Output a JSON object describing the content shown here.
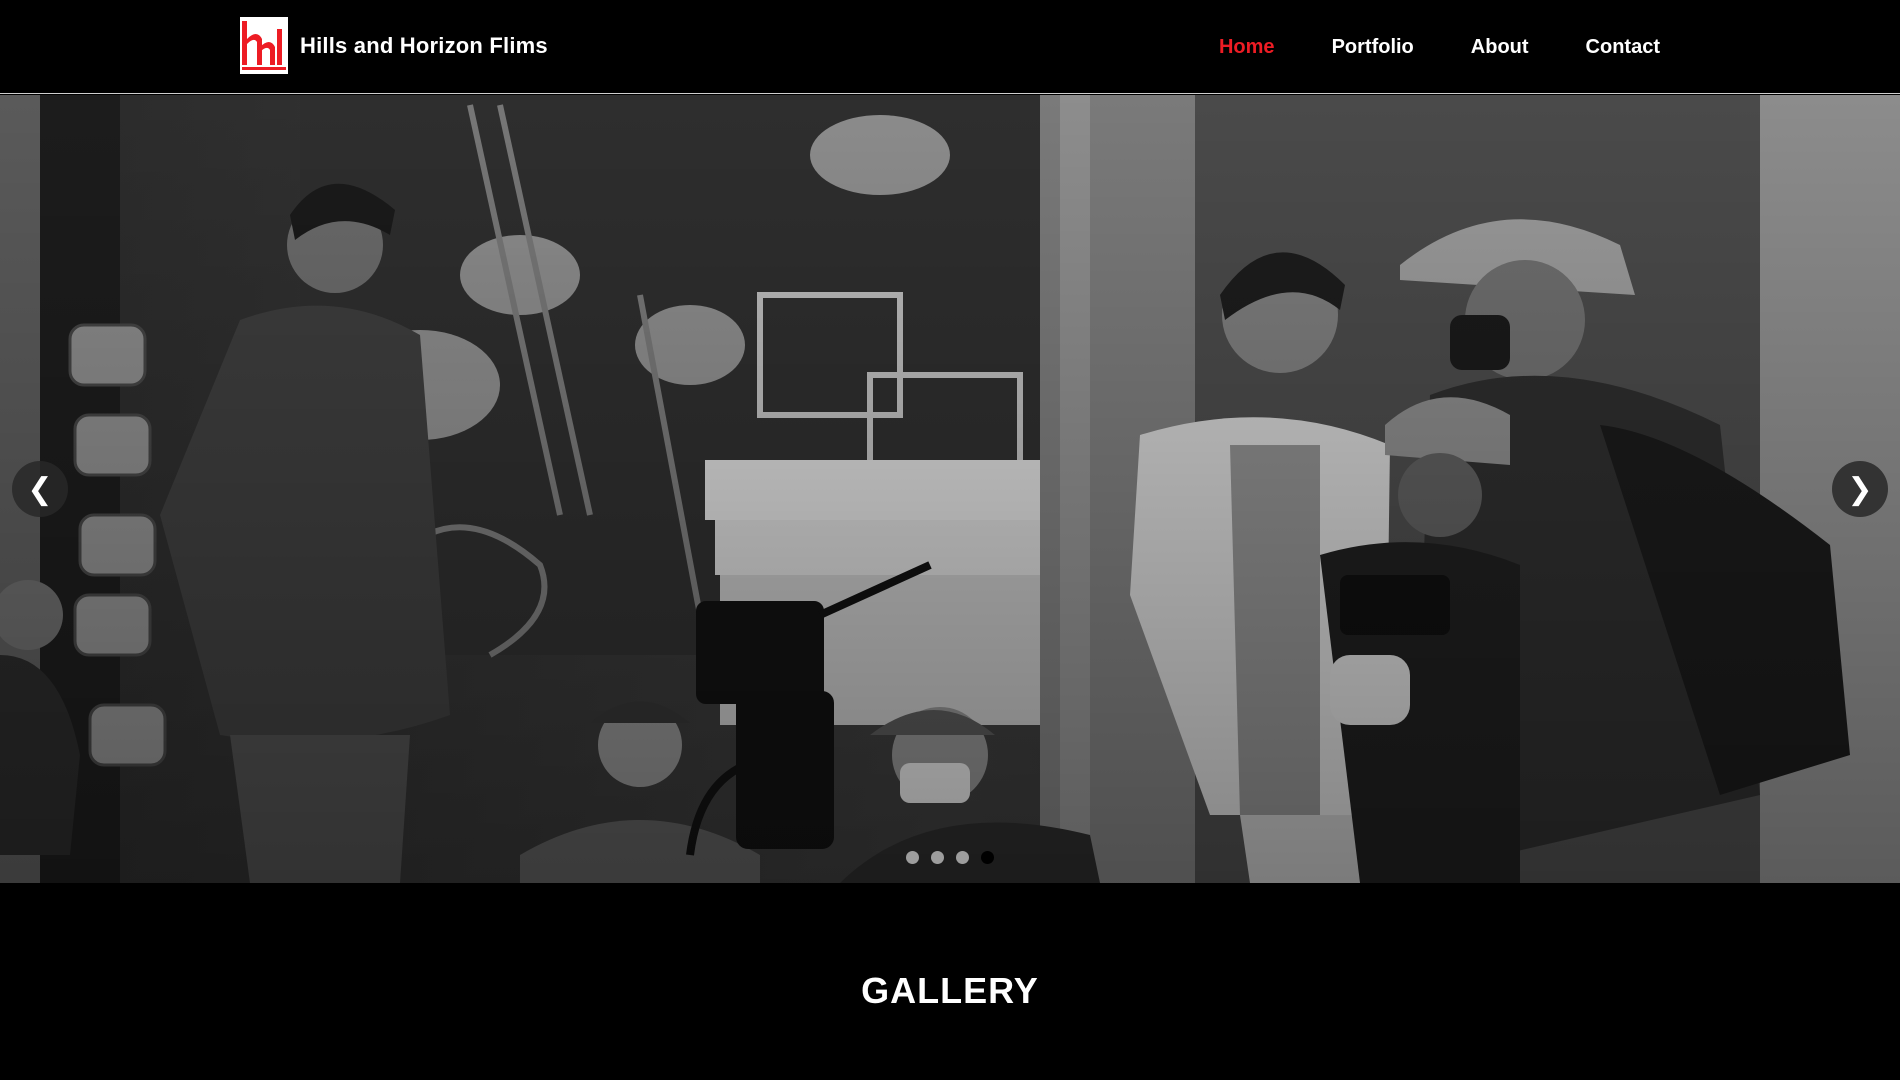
{
  "brand": {
    "name": "Hills and Horizon Flims",
    "logo_icon": "hh-films-logo-icon",
    "accent_color": "#ed1c24"
  },
  "nav": {
    "items": [
      {
        "label": "Home",
        "active": true
      },
      {
        "label": "Portfolio",
        "active": false
      },
      {
        "label": "About",
        "active": false
      },
      {
        "label": "Contact",
        "active": false
      }
    ]
  },
  "carousel": {
    "prev_symbol": "❮",
    "next_symbol": "❯",
    "slide_count": 4,
    "active_slide": 4,
    "image": "black-and-white-film-crew-street-photo"
  },
  "section": {
    "title": "GALLERY"
  }
}
